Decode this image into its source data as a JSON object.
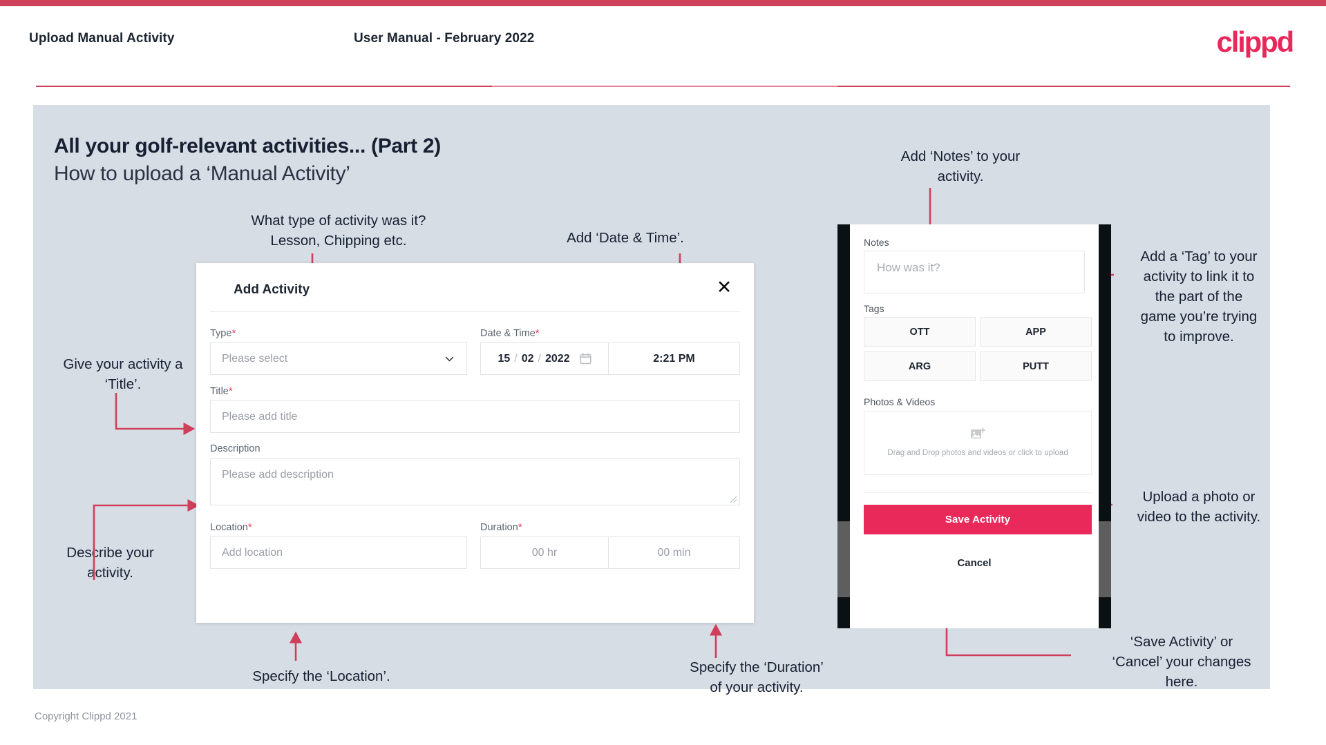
{
  "header": {
    "left_title": "Upload Manual Activity",
    "center_title": "User Manual - February 2022",
    "logo": "clippd"
  },
  "slide": {
    "title": "All your golf-relevant activities... (Part 2)",
    "subtitle": "How to upload a ‘Manual Activity’"
  },
  "dialog": {
    "title": "Add Activity",
    "close_icon": "close-icon",
    "fields": {
      "type": {
        "label": "Type",
        "required": "*",
        "placeholder": "Please select",
        "chevron_icon": "chevron-down-icon"
      },
      "datetime": {
        "label": "Date & Time",
        "required": "*",
        "day": "15",
        "sep1": "/",
        "month": "02",
        "sep2": "/",
        "year": "2022",
        "calendar_icon": "calendar-icon",
        "time": "2:21 PM"
      },
      "title": {
        "label": "Title",
        "required": "*",
        "placeholder": "Please add title"
      },
      "description": {
        "label": "Description",
        "required": "",
        "placeholder": "Please add description"
      },
      "location": {
        "label": "Location",
        "required": "*",
        "placeholder": "Add location"
      },
      "duration": {
        "label": "Duration",
        "required": "*",
        "hours_placeholder": "00 hr",
        "minutes_placeholder": "00 min"
      }
    }
  },
  "phone": {
    "notes": {
      "label": "Notes",
      "placeholder": "How was it?"
    },
    "tags": {
      "label": "Tags",
      "items": [
        "OTT",
        "APP",
        "ARG",
        "PUTT"
      ]
    },
    "photos": {
      "label": "Photos & Videos",
      "icon": "add-image-icon",
      "caption": "Drag and Drop photos and videos or\nclick to upload"
    },
    "save_label": "Save Activity",
    "cancel_label": "Cancel"
  },
  "annotations": {
    "type": "What type of activity was it?\nLesson, Chipping etc.",
    "datetime": "Add ‘Date & Time’.",
    "title": "Give your activity a\n‘Title’.",
    "description": "Describe your\nactivity.",
    "location": "Specify the ‘Location’.",
    "duration": "Specify the ‘Duration’\nof your activity.",
    "notes": "Add ‘Notes’ to your\nactivity.",
    "tags": "Add a ‘Tag’ to your\nactivity to link it to\nthe part of the\ngame you’re trying\nto improve.",
    "photos": "Upload a photo or\nvideo to the activity.",
    "save": "‘Save Activity’ or\n‘Cancel’ your changes\nhere."
  },
  "footer": {
    "copyright": "Copyright Clippd 2021"
  },
  "colors": {
    "brand": "#e8285a",
    "accent_bar": "#cf4259",
    "panel": "#d7dde4",
    "arrow": "#cf3e5b",
    "text_dark": "#152033"
  }
}
